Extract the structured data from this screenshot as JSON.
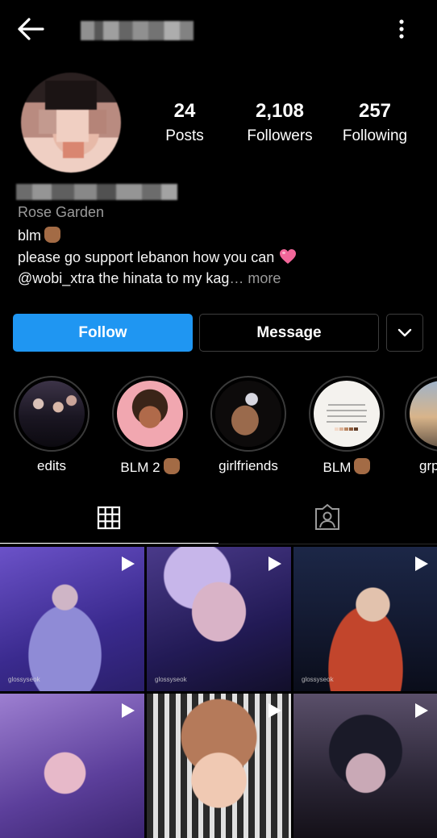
{
  "header": {
    "back_icon": "arrow-left-icon",
    "more_icon": "vertical-dots-icon"
  },
  "stats": [
    {
      "value": "24",
      "label": "Posts"
    },
    {
      "value": "2,108",
      "label": "Followers"
    },
    {
      "value": "257",
      "label": "Following"
    }
  ],
  "bio": {
    "category": "Rose Garden",
    "line1": "blm",
    "line2": "please go support lebanon how you can",
    "line3_text": "@wobi_xtra the hinata to my kag",
    "line3_more": "… more"
  },
  "buttons": {
    "follow": "Follow",
    "message": "Message"
  },
  "highlights": [
    {
      "label": "edits"
    },
    {
      "label": "BLM 2"
    },
    {
      "label": "girlfriends"
    },
    {
      "label": "BLM"
    },
    {
      "label": "grp"
    }
  ],
  "posts": [
    {
      "watermark": "glossyseok"
    },
    {
      "watermark": "glossyseok"
    },
    {
      "watermark": "glossyseok"
    },
    {
      "watermark": ""
    },
    {
      "watermark": ""
    },
    {
      "watermark": ""
    }
  ],
  "colors": {
    "accent": "#1f96f2",
    "background": "#000000",
    "muted": "#9a9a9a"
  }
}
